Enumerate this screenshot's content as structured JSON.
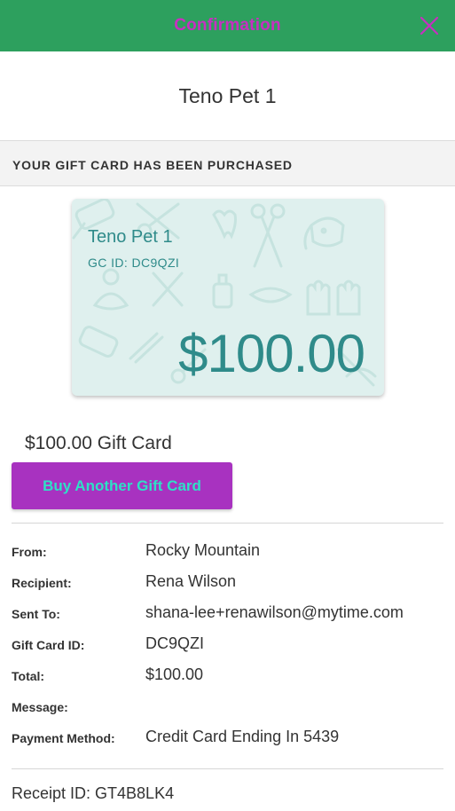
{
  "header": {
    "title": "Confirmation",
    "background_color": "#2da05e",
    "title_color": "#c82fc1",
    "close_icon": "close-icon"
  },
  "merchant_name": "Teno Pet 1",
  "banner": {
    "text": "YOUR GIFT CARD HAS BEEN PURCHASED"
  },
  "gift_card": {
    "merchant": "Teno Pet 1",
    "id_label": "GC ID: DC9QZI",
    "amount": "$100.00",
    "background_color": "#dff0ee",
    "text_color": "#2f8b8a"
  },
  "gift_card_label": "$100.00 Gift Card",
  "buy_button": {
    "label": "Buy Another Gift Card",
    "background_color": "#a832c0",
    "text_color": "#2ee0c6"
  },
  "details": [
    {
      "label": "From:",
      "value": "Rocky Mountain"
    },
    {
      "label": "Recipient:",
      "value": "Rena Wilson"
    },
    {
      "label": "Sent To:",
      "value": "shana-lee+renawilson@mytime.com"
    },
    {
      "label": "Gift Card ID:",
      "value": "DC9QZI"
    },
    {
      "label": "Total:",
      "value": "$100.00"
    },
    {
      "label": "Message:",
      "value": ""
    },
    {
      "label": "Payment Method:",
      "value": "Credit Card Ending In 5439"
    }
  ],
  "receipt": "Receipt ID: GT4B8LK4"
}
